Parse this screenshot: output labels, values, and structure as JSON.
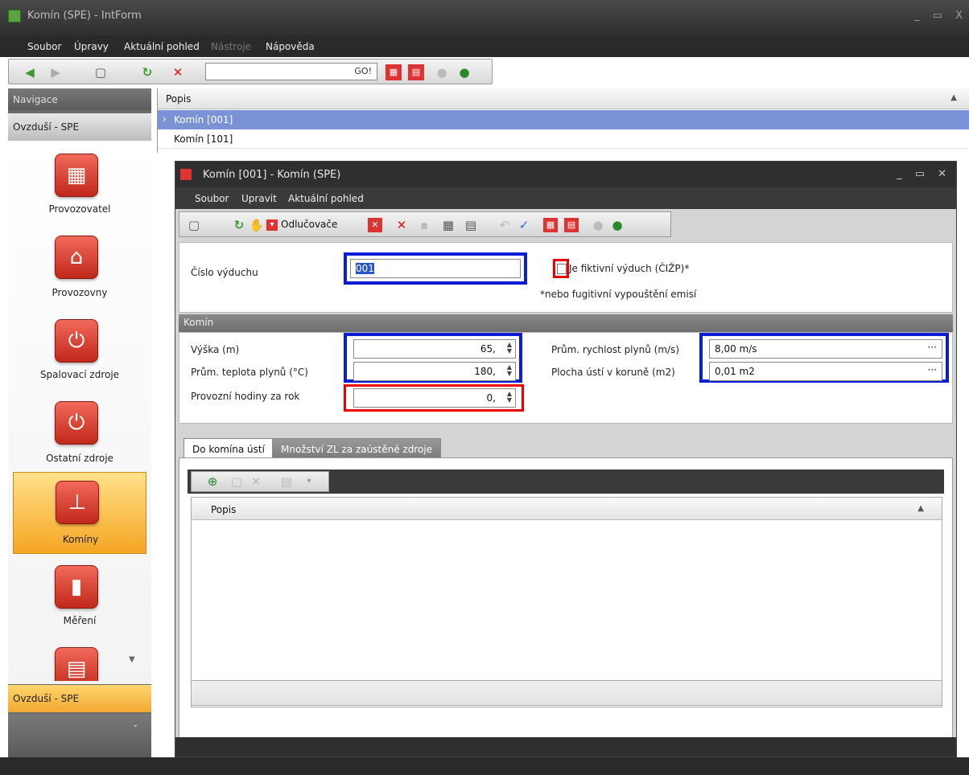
{
  "window": {
    "title": "Komín (SPE) - IntForm",
    "buttons": [
      "_",
      "▭",
      "X"
    ]
  },
  "menu": [
    "Soubor",
    "Úpravy",
    "Aktuální pohled",
    "Nástroje",
    "Nápověda"
  ],
  "toolbar": {
    "go_label": "GO!",
    "search_value": ""
  },
  "nav": {
    "header": "Navigace",
    "group": "Ovzduší - SPE",
    "items": [
      {
        "label": "Provozovatel",
        "icon": "building-icon"
      },
      {
        "label": "Provozovny",
        "icon": "factory-icon"
      },
      {
        "label": "Spalovací zdroje",
        "icon": "power-icon"
      },
      {
        "label": "Ostatní zdroje",
        "icon": "power-icon"
      },
      {
        "label": "Komíny",
        "icon": "chimney-icon",
        "selected": true
      },
      {
        "label": "Měření",
        "icon": "chart-icon"
      }
    ],
    "bottom_group": "Ovzduší - SPE"
  },
  "grid": {
    "header": "Popis",
    "rows": [
      "Komín [001]",
      "Komín [101]"
    ]
  },
  "child": {
    "title": "Komín [001] - Komín (SPE)",
    "menu": [
      "Soubor",
      "Upravit",
      "Aktuální pohled"
    ],
    "tool_odl": "Odlučovače",
    "cislo_label": "Číslo výduchu",
    "cislo_value": "001",
    "fikt_label": "Je fiktivní výduch (ČIŽP)*",
    "fikt_note": "*nebo fugitivní vypouštění emisí",
    "section": "Komín",
    "vyska_label": "Výška (m)",
    "vyska_value": "65,",
    "teplota_label": "Prům. teplota plynů (°C)",
    "teplota_value": "180,",
    "hodiny_label": "Provozní hodiny za rok",
    "hodiny_value": "0,",
    "rychlost_label": "Prům. rychlost plynů (m/s)",
    "rychlost_value": "8,00 m/s",
    "plocha_label": "Plocha ústí v koruně (m2)",
    "plocha_value": "0,01 m2",
    "tabs": [
      "Do komína ústí",
      "Množství ZL za zaústěné zdroje"
    ],
    "subgrid_header": "Popis"
  }
}
